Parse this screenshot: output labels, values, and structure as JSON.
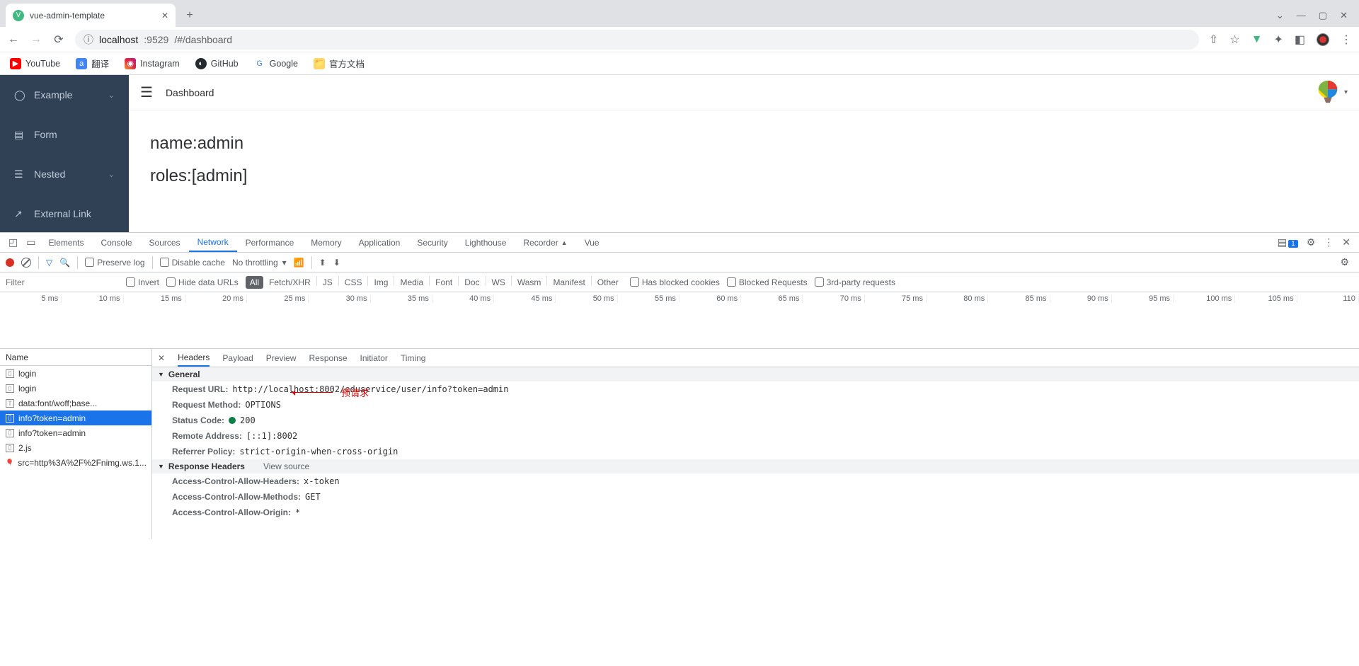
{
  "browser": {
    "tab_title": "vue-admin-template",
    "url_host": "localhost",
    "url_port": ":9529",
    "url_path": "/#/dashboard",
    "bookmarks": [
      {
        "label": "YouTube",
        "ico": "yt"
      },
      {
        "label": "翻译",
        "ico": "tr"
      },
      {
        "label": "Instagram",
        "ico": "ig"
      },
      {
        "label": "GitHub",
        "ico": "gh"
      },
      {
        "label": "Google",
        "ico": "gg"
      },
      {
        "label": "官方文档",
        "ico": "fd"
      }
    ]
  },
  "app": {
    "sidebar": [
      {
        "label": "Example",
        "icon": "◯",
        "chev": true
      },
      {
        "label": "Form",
        "icon": "▤",
        "chev": false
      },
      {
        "label": "Nested",
        "icon": "☰",
        "chev": true
      },
      {
        "label": "External Link",
        "icon": "↗",
        "chev": false
      }
    ],
    "breadcrumb": "Dashboard",
    "content_line1": "name:admin",
    "content_line2": "roles:[admin]"
  },
  "devtools": {
    "tabs": [
      "Elements",
      "Console",
      "Sources",
      "Network",
      "Performance",
      "Memory",
      "Application",
      "Security",
      "Lighthouse",
      "Recorder",
      "Vue"
    ],
    "active_tab": "Network",
    "issues_count": "1",
    "toolbar": {
      "preserve_log": "Preserve log",
      "disable_cache": "Disable cache",
      "throttling": "No throttling"
    },
    "filter": {
      "placeholder": "Filter",
      "invert": "Invert",
      "hide_data": "Hide data URLs",
      "types": [
        "All",
        "Fetch/XHR",
        "JS",
        "CSS",
        "Img",
        "Media",
        "Font",
        "Doc",
        "WS",
        "Wasm",
        "Manifest",
        "Other"
      ],
      "active_type": "All",
      "blocked_cookies": "Has blocked cookies",
      "blocked_req": "Blocked Requests",
      "third_party": "3rd-party requests"
    },
    "timeline_ticks": [
      "5 ms",
      "10 ms",
      "15 ms",
      "20 ms",
      "25 ms",
      "30 ms",
      "35 ms",
      "40 ms",
      "45 ms",
      "50 ms",
      "55 ms",
      "60 ms",
      "65 ms",
      "70 ms",
      "75 ms",
      "80 ms",
      "85 ms",
      "90 ms",
      "95 ms",
      "100 ms",
      "105 ms",
      "110"
    ],
    "name_header": "Name",
    "requests": [
      {
        "name": "login",
        "sel": false
      },
      {
        "name": "login",
        "sel": false
      },
      {
        "name": "data:font/woff;base...",
        "sel": false
      },
      {
        "name": "info?token=admin",
        "sel": true
      },
      {
        "name": "info?token=admin",
        "sel": false
      },
      {
        "name": "2.js",
        "sel": false
      },
      {
        "name": "src=http%3A%2F%2Fnimg.ws.1...",
        "sel": false
      }
    ],
    "subtabs": [
      "Headers",
      "Payload",
      "Preview",
      "Response",
      "Initiator",
      "Timing"
    ],
    "active_subtab": "Headers",
    "general_title": "General",
    "general": [
      {
        "k": "Request URL:",
        "v": "http://localhost:8002/eduservice/user/info?token=admin"
      },
      {
        "k": "Request Method:",
        "v": "OPTIONS"
      },
      {
        "k": "Status Code:",
        "v": "200",
        "status": true
      },
      {
        "k": "Remote Address:",
        "v": "[::1]:8002"
      },
      {
        "k": "Referrer Policy:",
        "v": "strict-origin-when-cross-origin"
      }
    ],
    "resp_headers_title": "Response Headers",
    "view_source": "View source",
    "resp_headers": [
      {
        "k": "Access-Control-Allow-Headers:",
        "v": "x-token"
      },
      {
        "k": "Access-Control-Allow-Methods:",
        "v": "GET"
      },
      {
        "k": "Access-Control-Allow-Origin:",
        "v": "*"
      }
    ],
    "annotation": "预请求"
  }
}
